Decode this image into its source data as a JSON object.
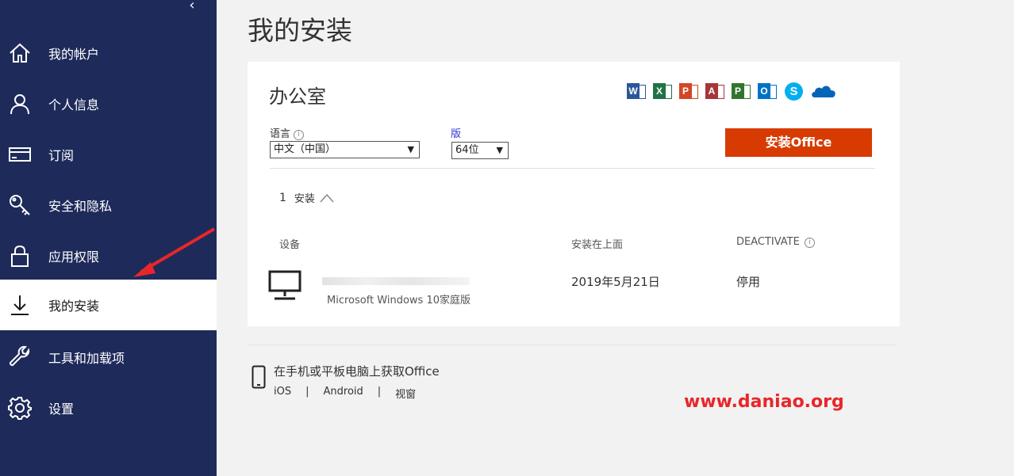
{
  "sidebar": {
    "collapse_glyph": "‹",
    "items": [
      {
        "label": "我的帐户",
        "icon": "home-icon"
      },
      {
        "label": "个人信息",
        "icon": "person-icon"
      },
      {
        "label": "订阅",
        "icon": "card-icon"
      },
      {
        "label": "安全和隐私",
        "icon": "key-icon"
      },
      {
        "label": "应用权限",
        "icon": "lock-icon"
      },
      {
        "label": "我的安装",
        "icon": "download-icon",
        "active": true
      },
      {
        "label": "工具和加载项",
        "icon": "wrench-icon"
      },
      {
        "label": "设置",
        "icon": "gear-icon"
      }
    ]
  },
  "main": {
    "title": "我的安装",
    "card": {
      "title": "办公室",
      "app_icons": [
        {
          "name": "word-icon",
          "letter": "W",
          "color": "#2b579a"
        },
        {
          "name": "excel-icon",
          "letter": "X",
          "color": "#217346"
        },
        {
          "name": "powerpoint-icon",
          "letter": "P",
          "color": "#d24726"
        },
        {
          "name": "access-icon",
          "letter": "A",
          "color": "#a4373a"
        },
        {
          "name": "project-icon",
          "letter": "P",
          "color": "#31752f"
        },
        {
          "name": "outlook-icon",
          "letter": "O",
          "color": "#0072c6"
        },
        {
          "name": "skype-icon",
          "letter": "S",
          "color": "#00aff0"
        },
        {
          "name": "onedrive-icon",
          "letter": "",
          "color": "#0364b8"
        }
      ],
      "language_label": "语言",
      "language_value": "中文（中国）",
      "version_label": "版",
      "version_value": "64位",
      "install_button": "安装Office",
      "install_count": "1",
      "install_count_label": "安装",
      "columns": {
        "device": "设备",
        "installed_on": "安装在上面",
        "deactivate": "DEACTIVATE"
      },
      "device": {
        "os": "Microsoft Windows 10家庭版",
        "installed_on": "2019年5月21日",
        "action": "停用"
      }
    },
    "mobile": {
      "title": "在手机或平板电脑上获取Office",
      "links": [
        "iOS",
        "Android",
        "视窗"
      ]
    }
  },
  "watermark": "www.daniao.org",
  "colors": {
    "sidebar_bg": "#1e2a5a",
    "install_button": "#d83b01",
    "watermark": "#e8262a",
    "arrow": "#e8262a"
  }
}
